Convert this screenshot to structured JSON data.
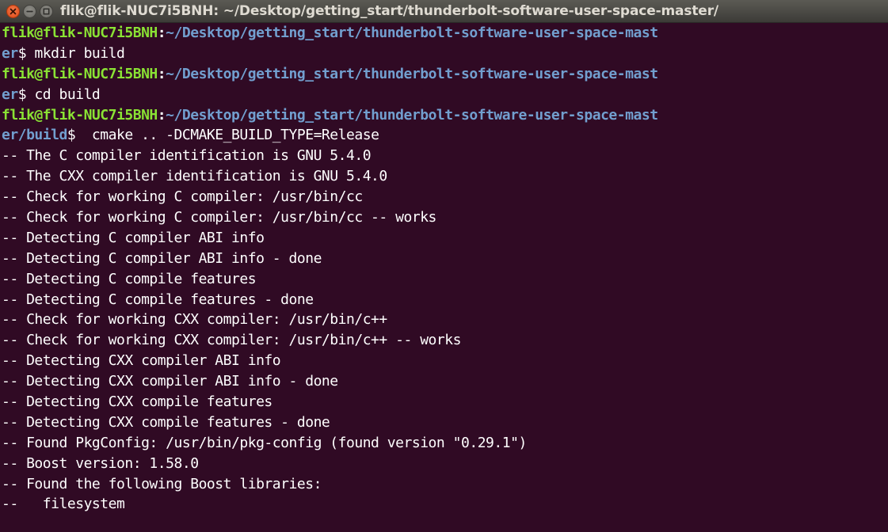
{
  "window": {
    "title": "flik@flik-NUC7i5BNH: ~/Desktop/getting_start/thunderbolt-software-user-space-master/"
  },
  "colors": {
    "background": "#300a24",
    "prompt_user": "#8ae234",
    "prompt_path": "#729fcf",
    "text": "#ffffff"
  },
  "icons": {
    "close": "close-icon",
    "minimize": "minimize-icon",
    "maximize": "maximize-icon"
  },
  "terminal": {
    "lines": [
      {
        "user": "flik@flik-NUC7i5BNH",
        "sep": ":",
        "path": "~/Desktop/getting_start/thunderbolt-software-user-space-mast"
      },
      {
        "path": "er",
        "sign": "$ ",
        "text": "mkdir build"
      },
      {
        "user": "flik@flik-NUC7i5BNH",
        "sep": ":",
        "path": "~/Desktop/getting_start/thunderbolt-software-user-space-mast"
      },
      {
        "path": "er",
        "sign": "$ ",
        "text": "cd build"
      },
      {
        "user": "flik@flik-NUC7i5BNH",
        "sep": ":",
        "path": "~/Desktop/getting_start/thunderbolt-software-user-space-mast"
      },
      {
        "path": "er/build",
        "sign": "$ ",
        "text": " cmake .. -DCMAKE_BUILD_TYPE=Release"
      },
      {
        "text": "-- The C compiler identification is GNU 5.4.0"
      },
      {
        "text": "-- The CXX compiler identification is GNU 5.4.0"
      },
      {
        "text": "-- Check for working C compiler: /usr/bin/cc"
      },
      {
        "text": "-- Check for working C compiler: /usr/bin/cc -- works"
      },
      {
        "text": "-- Detecting C compiler ABI info"
      },
      {
        "text": "-- Detecting C compiler ABI info - done"
      },
      {
        "text": "-- Detecting C compile features"
      },
      {
        "text": "-- Detecting C compile features - done"
      },
      {
        "text": "-- Check for working CXX compiler: /usr/bin/c++"
      },
      {
        "text": "-- Check for working CXX compiler: /usr/bin/c++ -- works"
      },
      {
        "text": "-- Detecting CXX compiler ABI info"
      },
      {
        "text": "-- Detecting CXX compiler ABI info - done"
      },
      {
        "text": "-- Detecting CXX compile features"
      },
      {
        "text": "-- Detecting CXX compile features - done"
      },
      {
        "text": "-- Found PkgConfig: /usr/bin/pkg-config (found version \"0.29.1\")"
      },
      {
        "text": "-- Boost version: 1.58.0"
      },
      {
        "text": "-- Found the following Boost libraries:"
      },
      {
        "text": "--   filesystem"
      }
    ]
  }
}
